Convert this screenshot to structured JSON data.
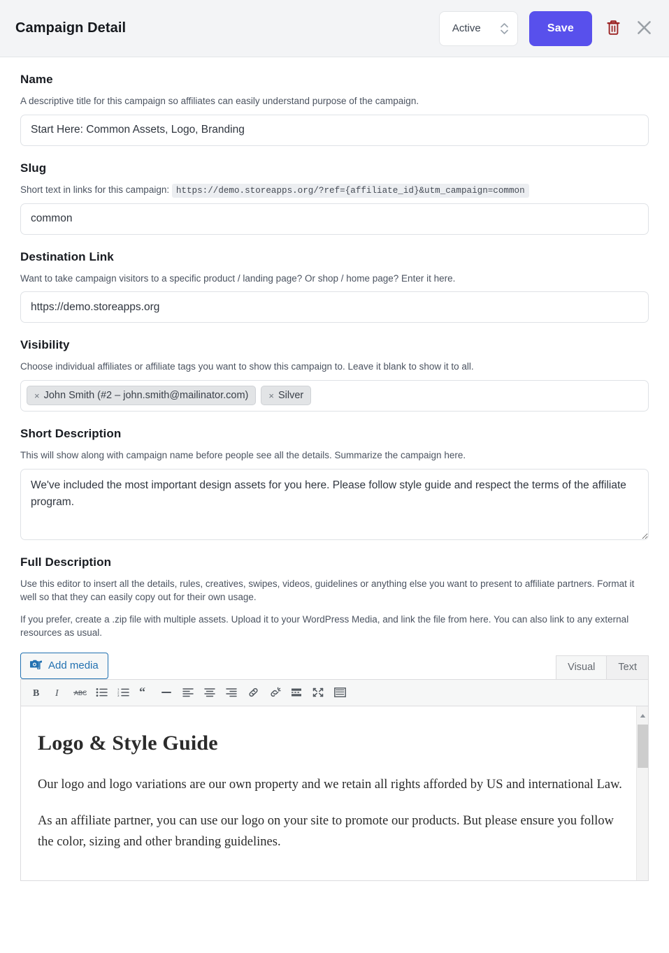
{
  "header": {
    "title": "Campaign Detail",
    "status_value": "Active",
    "save_label": "Save",
    "delete_title": "Delete",
    "close_title": "Close",
    "accent_color": "#5850ec",
    "delete_color": "#9b2323",
    "close_color": "#9aa0a6",
    "background": "#f3f4f6"
  },
  "fields": {
    "name": {
      "label": "Name",
      "help": "A descriptive title for this campaign so affiliates can easily understand purpose of the campaign.",
      "value": "Start Here: Common Assets, Logo, Branding",
      "placeholder": ""
    },
    "slug": {
      "label": "Slug",
      "help": "Short text in links for this campaign:",
      "code": "https://demo.storeapps.org/?ref={affiliate_id}&utm_campaign=common",
      "value": "common",
      "placeholder": ""
    },
    "destination_link": {
      "label": "Destination Link",
      "help": "Want to take campaign visitors to a specific product / landing page? Or shop / home page? Enter it here.",
      "value": "https://demo.storeapps.org",
      "placeholder": ""
    },
    "visibility": {
      "label": "Visibility",
      "help": "Choose individual affiliates or affiliate tags you want to show this campaign to. Leave it blank to show it to all.",
      "tokens": [
        {
          "remove": "×",
          "label": "John Smith (#2 – john.smith@mailinator.com)"
        },
        {
          "remove": "×",
          "label": "Silver"
        }
      ]
    },
    "short_description": {
      "label": "Short Description",
      "help": "This will show along with campaign name before people see all the details. Summarize the campaign here.",
      "value": "We've included the most important design assets for you here. Please follow style guide and respect the terms of the affiliate program.",
      "placeholder": ""
    },
    "full_description": {
      "label": "Full Description",
      "help_1": "Use this editor to insert all the details, rules, creatives, swipes, videos, guidelines or anything else you want to present to affiliate partners. Format it well so that they can easily copy out for their own usage.",
      "help_2": "If you prefer, create a .zip file with multiple assets. Upload it to your WordPress Media, and link the file from here. You can also link to any external resources as usual."
    }
  },
  "editor": {
    "add_media_label": "Add media",
    "tabs": [
      {
        "label": "Visual",
        "active": true
      },
      {
        "label": "Text",
        "active": false
      }
    ],
    "toolbar_icons": [
      "bold-icon",
      "italic-icon",
      "strikethrough-icon",
      "bulleted-list-icon",
      "numbered-list-icon",
      "blockquote-icon",
      "horizontal-rule-icon",
      "align-left-icon",
      "align-center-icon",
      "align-right-icon",
      "insert-link-icon",
      "remove-link-icon",
      "read-more-icon",
      "fullscreen-icon",
      "toolbar-toggle-icon"
    ],
    "content": {
      "heading": "Logo & Style Guide",
      "paragraphs": [
        "Our logo and logo variations are our own property and we retain all rights afforded by US and international Law.",
        "As an affiliate partner, you can use our logo on your site to promote our products. But please ensure you follow the color, sizing and other branding guidelines."
      ]
    }
  }
}
